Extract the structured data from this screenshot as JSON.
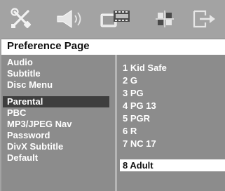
{
  "toolbar": {
    "icons": [
      {
        "name": "general-setup-icon"
      },
      {
        "name": "audio-setup-icon"
      },
      {
        "name": "video-setup-icon"
      },
      {
        "name": "preference-setup-icon"
      },
      {
        "name": "exit-icon"
      }
    ],
    "active_icon": "preference-setup-icon"
  },
  "header": {
    "title": "Preference Page"
  },
  "menu": {
    "items": [
      "Audio",
      "Subtitle",
      "Disc Menu",
      "Parental",
      "PBC",
      "MP3/JPEG Nav",
      "Password",
      "DivX Subtitle",
      "Default"
    ],
    "selected": "Parental"
  },
  "options": {
    "items": [
      "1 Kid Safe",
      "2 G",
      "3 PG",
      "4 PG 13",
      "5 PGR",
      "6 R",
      "7 NC 17",
      "8 Adult"
    ],
    "selected": "8 Adult"
  },
  "colors": {
    "background": "#a3a3a3",
    "panel": "#8c8c8c",
    "menu_highlight": "#3e3e3e",
    "option_highlight": "#ffffff"
  }
}
